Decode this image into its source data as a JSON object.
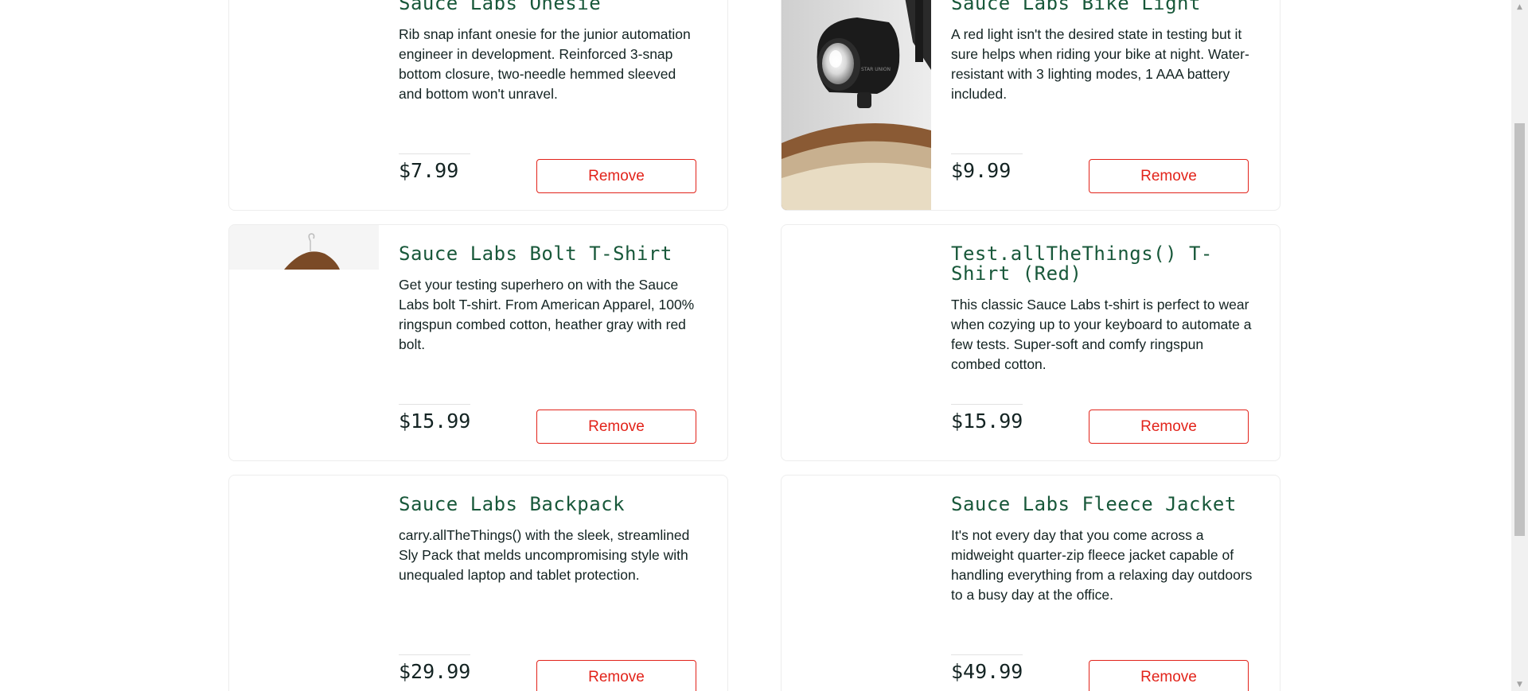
{
  "cart_items": [
    {
      "title": "Sauce Labs Onesie",
      "description": "Rib snap infant onesie for the junior automation engineer in development. Reinforced 3-snap bottom closure, two-needle hemmed sleeved and bottom won't unravel.",
      "price": "$7.99",
      "remove_label": "Remove",
      "image": "onesie-image"
    },
    {
      "title": "Sauce Labs Bike Light",
      "description": "A red light isn't the desired state in testing but it sure helps when riding your bike at night. Water-resistant with 3 lighting modes, 1 AAA battery included.",
      "price": "$9.99",
      "remove_label": "Remove",
      "image": "bike-light-image",
      "image_brand_text": "STAR UNION"
    },
    {
      "title": "Sauce Labs Bolt T-Shirt",
      "description": "Get your testing superhero on with the Sauce Labs bolt T-shirt. From American Apparel, 100% ringspun combed cotton, heather gray with red bolt.",
      "price": "$15.99",
      "remove_label": "Remove",
      "image": "hanger-image"
    },
    {
      "title": "Test.allTheThings() T-Shirt (Red)",
      "description": "This classic Sauce Labs t-shirt is perfect to wear when cozying up to your keyboard to automate a few tests. Super-soft and comfy ringspun combed cotton.",
      "price": "$15.99",
      "remove_label": "Remove",
      "image": "red-tshirt-image"
    },
    {
      "title": "Sauce Labs Backpack",
      "description": "carry.allTheThings() with the sleek, streamlined Sly Pack that melds uncompromising style with unequaled laptop and tablet protection.",
      "price": "$29.99",
      "remove_label": "Remove",
      "image": "backpack-image"
    },
    {
      "title": "Sauce Labs Fleece Jacket",
      "description": "It's not every day that you come across a midweight quarter-zip fleece jacket capable of handling everything from a relaxing day outdoors to a busy day at the office.",
      "price": "$49.99",
      "remove_label": "Remove",
      "image": "fleece-jacket-image"
    }
  ],
  "colors": {
    "title": "#18583a",
    "text": "#132322",
    "remove": "#e2231a",
    "card_border": "#ededed"
  },
  "icons": {
    "scroll_up": "triangle-up-icon",
    "scroll_down": "triangle-down-icon"
  }
}
